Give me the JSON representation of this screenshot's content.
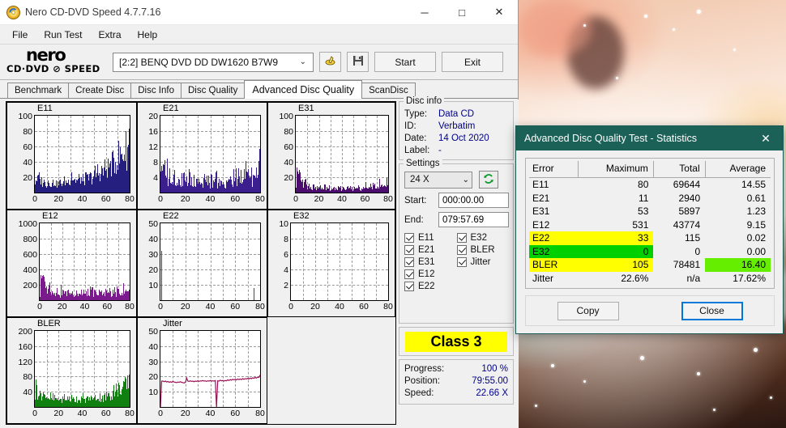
{
  "window": {
    "title": "Nero CD-DVD Speed 4.7.7.16",
    "icon": "nero-disc-icon",
    "minimize_label": "─",
    "maximize_label": "□",
    "close_label": "✕"
  },
  "menu": {
    "items": [
      "File",
      "Run Test",
      "Extra",
      "Help"
    ]
  },
  "toolbar": {
    "logo_main": "nero",
    "logo_sub": "CD·DVD ⊘ SPEED",
    "drive_selected": "[2:2]   BENQ DVD DD DW1620 B7W9",
    "drive_chevron": "⌄",
    "eject_icon": "eject-disc-icon",
    "save_icon": "floppy-save-icon",
    "start_label": "Start",
    "exit_label": "Exit"
  },
  "tabs": {
    "items": [
      "Benchmark",
      "Create Disc",
      "Disc Info",
      "Disc Quality",
      "Advanced Disc Quality",
      "ScanDisc"
    ],
    "active": "Advanced Disc Quality"
  },
  "disc_info": {
    "legend": "Disc info",
    "rows": [
      {
        "key": "Type:",
        "value": "Data CD"
      },
      {
        "key": "ID:",
        "value": "Verbatim"
      },
      {
        "key": "Date:",
        "value": "14 Oct 2020"
      },
      {
        "key": "Label:",
        "value": "-"
      }
    ]
  },
  "settings": {
    "legend": "Settings",
    "speed": "24 X",
    "speed_chevron": "⌄",
    "refresh_icon": "refresh-green-icon",
    "start_label": "Start:",
    "start_value": "000:00.00",
    "end_label": "End:",
    "end_value": "079:57.69",
    "checkboxes": [
      {
        "label": "E11",
        "checked": true
      },
      {
        "label": "E32",
        "checked": true
      },
      {
        "label": "E21",
        "checked": true
      },
      {
        "label": "BLER",
        "checked": true
      },
      {
        "label": "E31",
        "checked": true
      },
      {
        "label": "Jitter",
        "checked": true
      },
      {
        "label": "E12",
        "checked": true
      },
      {
        "label": "",
        "checked": false
      },
      {
        "label": "E22",
        "checked": true
      },
      {
        "label": "",
        "checked": false
      }
    ]
  },
  "class_badge": {
    "label": "Class 3",
    "bg": "#ffff00"
  },
  "progress": {
    "rows": [
      {
        "key": "Progress:",
        "value": "100 %"
      },
      {
        "key": "Position:",
        "value": "79:55.00"
      },
      {
        "key": "Speed:",
        "value": "22.66 X"
      }
    ]
  },
  "stats_dialog": {
    "title": "Advanced Disc Quality Test - Statistics",
    "close_icon": "close-icon",
    "close_label": "✕",
    "headers": [
      "Error",
      "Maximum",
      "Total",
      "Average"
    ],
    "rows": [
      {
        "error": "E11",
        "maximum": "80",
        "total": "69644",
        "average": "14.55",
        "hl_error": "",
        "hl_max": "",
        "hl_avg": ""
      },
      {
        "error": "E21",
        "maximum": "11",
        "total": "2940",
        "average": "0.61",
        "hl_error": "",
        "hl_max": "",
        "hl_avg": ""
      },
      {
        "error": "E31",
        "maximum": "53",
        "total": "5897",
        "average": "1.23",
        "hl_error": "",
        "hl_max": "",
        "hl_avg": ""
      },
      {
        "error": "E12",
        "maximum": "531",
        "total": "43774",
        "average": "9.15",
        "hl_error": "",
        "hl_max": "",
        "hl_avg": ""
      },
      {
        "error": "E22",
        "maximum": "33",
        "total": "115",
        "average": "0.02",
        "hl_error": "#ffff00",
        "hl_max": "#ffff00",
        "hl_avg": ""
      },
      {
        "error": "E32",
        "maximum": "0",
        "total": "0",
        "average": "0.00",
        "hl_error": "#00d000",
        "hl_max": "#00d000",
        "hl_avg": ""
      },
      {
        "error": "BLER",
        "maximum": "105",
        "total": "78481",
        "average": "16.40",
        "hl_error": "#ffff00",
        "hl_max": "#ffff00",
        "hl_avg": "#66ee00"
      },
      {
        "error": "Jitter",
        "maximum": "22.6%",
        "total": "n/a",
        "average": "17.62%",
        "hl_error": "",
        "hl_max": "",
        "hl_avg": ""
      }
    ],
    "copy_label": "Copy",
    "close_button_label": "Close"
  },
  "chart_data": [
    {
      "id": "e11",
      "type": "area",
      "title": "E11",
      "color": "#252080",
      "xlabel": "",
      "ylabel": "",
      "xlim": [
        0,
        80
      ],
      "ylim": [
        0,
        100
      ],
      "xticks": [
        0,
        20,
        40,
        60,
        80
      ],
      "yticks": [
        20,
        40,
        60,
        80,
        100
      ],
      "grid": true,
      "x": [
        0,
        1,
        2,
        3,
        4,
        5,
        6,
        7,
        8,
        9,
        10,
        11,
        12,
        13,
        14,
        15,
        16,
        17,
        18,
        19,
        20,
        21,
        22,
        23,
        24,
        25,
        26,
        27,
        28,
        29,
        30,
        31,
        32,
        33,
        34,
        35,
        36,
        37,
        38,
        39,
        40,
        41,
        42,
        43,
        44,
        45,
        46,
        47,
        48,
        49,
        50,
        51,
        52,
        53,
        54,
        55,
        56,
        57,
        58,
        59,
        60,
        61,
        62,
        63,
        64,
        65,
        66,
        67,
        68,
        69,
        70,
        71,
        72,
        73,
        74,
        75,
        76,
        77,
        78,
        79,
        80
      ],
      "values": [
        15,
        22,
        18,
        25,
        17,
        20,
        15,
        19,
        13,
        16,
        12,
        18,
        14,
        16,
        12,
        15,
        13,
        17,
        12,
        14,
        12,
        16,
        13,
        15,
        14,
        18,
        15,
        17,
        16,
        20,
        18,
        34,
        19,
        22,
        17,
        20,
        16,
        21,
        18,
        22,
        17,
        20,
        18,
        23,
        19,
        22,
        20,
        24,
        21,
        25,
        23,
        28,
        25,
        33,
        27,
        31,
        29,
        34,
        31,
        36,
        33,
        38,
        36,
        42,
        38,
        44,
        41,
        48,
        44,
        52,
        47,
        55,
        50,
        58,
        53,
        62,
        57,
        66,
        61,
        69,
        80
      ]
    },
    {
      "id": "e21",
      "type": "area",
      "title": "E21",
      "color": "#3b1f8f",
      "xlabel": "",
      "ylabel": "",
      "xlim": [
        0,
        80
      ],
      "ylim": [
        0,
        20
      ],
      "xticks": [
        0,
        20,
        40,
        60,
        80
      ],
      "yticks": [
        4,
        8,
        12,
        16,
        20
      ],
      "grid": true,
      "x": [
        0,
        1,
        2,
        3,
        4,
        5,
        6,
        7,
        8,
        9,
        10,
        11,
        12,
        13,
        14,
        15,
        16,
        17,
        18,
        19,
        20,
        21,
        22,
        23,
        24,
        25,
        26,
        27,
        28,
        29,
        30,
        31,
        32,
        33,
        34,
        35,
        36,
        37,
        38,
        39,
        40,
        41,
        42,
        43,
        44,
        45,
        46,
        47,
        48,
        49,
        50,
        51,
        52,
        53,
        54,
        55,
        56,
        57,
        58,
        59,
        60,
        61,
        62,
        63,
        64,
        65,
        66,
        67,
        68,
        69,
        70,
        71,
        72,
        73,
        74,
        75,
        76,
        77,
        78,
        79,
        80
      ],
      "values": [
        8,
        9,
        6,
        8,
        4,
        9,
        3,
        7,
        2,
        6,
        3,
        8,
        2,
        5,
        1,
        6,
        2,
        4,
        3,
        7,
        1,
        5,
        2,
        6,
        3,
        4,
        1,
        5,
        2,
        6,
        3,
        5,
        2,
        4,
        1,
        5,
        3,
        6,
        2,
        4,
        2,
        5,
        1,
        4,
        3,
        6,
        2,
        5,
        1,
        4,
        2,
        3,
        1,
        4,
        2,
        5,
        3,
        4,
        2,
        5,
        3,
        6,
        2,
        5,
        4,
        7,
        3,
        6,
        4,
        8,
        5,
        9,
        4,
        7,
        3,
        6,
        4,
        8,
        5,
        7,
        11
      ]
    },
    {
      "id": "e31",
      "type": "area",
      "title": "E31",
      "color": "#4b0d6e",
      "xlabel": "",
      "ylabel": "",
      "xlim": [
        0,
        80
      ],
      "ylim": [
        0,
        100
      ],
      "xticks": [
        0,
        20,
        40,
        60,
        80
      ],
      "yticks": [
        20,
        40,
        60,
        80,
        100
      ],
      "grid": true,
      "x": [
        0,
        1,
        2,
        3,
        4,
        5,
        6,
        7,
        8,
        9,
        10,
        11,
        12,
        13,
        14,
        15,
        16,
        17,
        18,
        19,
        20,
        21,
        22,
        23,
        24,
        25,
        26,
        27,
        28,
        29,
        30,
        31,
        32,
        33,
        34,
        35,
        36,
        37,
        38,
        39,
        40,
        41,
        42,
        43,
        44,
        45,
        46,
        47,
        48,
        49,
        50,
        51,
        52,
        53,
        54,
        55,
        56,
        57,
        58,
        59,
        60,
        61,
        62,
        63,
        64,
        65,
        66,
        67,
        68,
        69,
        70,
        71,
        72,
        73,
        74,
        75,
        76,
        77,
        78,
        79,
        80
      ],
      "values": [
        10,
        53,
        18,
        33,
        12,
        26,
        9,
        20,
        14,
        22,
        8,
        17,
        6,
        14,
        5,
        12,
        7,
        13,
        4,
        10,
        6,
        11,
        3,
        9,
        5,
        12,
        4,
        8,
        6,
        10,
        3,
        9,
        5,
        11,
        4,
        7,
        3,
        10,
        5,
        8,
        2,
        9,
        4,
        7,
        3,
        8,
        5,
        10,
        3,
        7,
        4,
        9,
        2,
        8,
        5,
        11,
        3,
        7,
        4,
        9,
        6,
        12,
        5,
        10,
        4,
        13,
        6,
        11,
        7,
        14,
        5,
        12,
        8,
        15,
        6,
        13,
        7,
        16,
        9,
        14,
        20
      ]
    },
    {
      "id": "e12",
      "type": "area",
      "title": "E12",
      "color": "#7a1a8c",
      "xlabel": "",
      "ylabel": "",
      "xlim": [
        0,
        80
      ],
      "ylim": [
        0,
        1000
      ],
      "xticks": [
        0,
        20,
        40,
        60,
        80
      ],
      "yticks": [
        200,
        400,
        600,
        800,
        1000
      ],
      "grid": true,
      "x": [
        0,
        1,
        2,
        3,
        4,
        5,
        6,
        7,
        8,
        9,
        10,
        11,
        12,
        13,
        14,
        15,
        16,
        17,
        18,
        19,
        20,
        21,
        22,
        23,
        24,
        25,
        26,
        27,
        28,
        29,
        30,
        31,
        32,
        33,
        34,
        35,
        36,
        37,
        38,
        39,
        40,
        41,
        42,
        43,
        44,
        45,
        46,
        47,
        48,
        49,
        50,
        51,
        52,
        53,
        54,
        55,
        56,
        57,
        58,
        59,
        60,
        61,
        62,
        63,
        64,
        65,
        66,
        67,
        68,
        69,
        70,
        71,
        72,
        73,
        74,
        75,
        76,
        77,
        78,
        79,
        80
      ],
      "values": [
        60,
        531,
        240,
        350,
        200,
        300,
        120,
        220,
        180,
        260,
        100,
        190,
        60,
        160,
        110,
        200,
        70,
        150,
        40,
        170,
        90,
        180,
        50,
        140,
        100,
        190,
        60,
        130,
        80,
        170,
        45,
        120,
        95,
        180,
        55,
        110,
        75,
        160,
        40,
        130,
        85,
        170,
        50,
        120,
        70,
        150,
        95,
        185,
        60,
        140,
        80,
        165,
        45,
        125,
        90,
        175,
        55,
        135,
        100,
        190,
        65,
        145,
        85,
        170,
        50,
        130,
        95,
        180,
        60,
        150,
        110,
        190,
        70,
        160,
        100,
        185,
        75,
        165,
        120,
        175,
        160
      ]
    },
    {
      "id": "e22",
      "type": "area",
      "title": "E22",
      "color": "#8c1a8c",
      "xlabel": "",
      "ylabel": "",
      "xlim": [
        0,
        80
      ],
      "ylim": [
        0,
        50
      ],
      "xticks": [
        0,
        20,
        40,
        60,
        80
      ],
      "yticks": [
        10,
        20,
        30,
        40,
        50
      ],
      "grid": true,
      "x": [
        1,
        75
      ],
      "values": [
        32,
        8
      ]
    },
    {
      "id": "e32",
      "type": "area",
      "title": "E32",
      "color": "#8c1a8c",
      "xlabel": "",
      "ylabel": "",
      "xlim": [
        0,
        80
      ],
      "ylim": [
        0,
        10
      ],
      "xticks": [
        0,
        20,
        40,
        60,
        80
      ],
      "yticks": [
        2,
        4,
        6,
        8,
        10
      ],
      "grid": true,
      "x": [],
      "values": []
    },
    {
      "id": "bler",
      "type": "area",
      "title": "BLER",
      "color": "#108010",
      "xlabel": "",
      "ylabel": "",
      "xlim": [
        0,
        80
      ],
      "ylim": [
        0,
        200
      ],
      "xticks": [
        0,
        20,
        40,
        60,
        80
      ],
      "yticks": [
        40,
        80,
        120,
        160,
        200
      ],
      "grid": true,
      "x": [
        0,
        1,
        2,
        3,
        4,
        5,
        6,
        7,
        8,
        9,
        10,
        11,
        12,
        13,
        14,
        15,
        16,
        17,
        18,
        19,
        20,
        21,
        22,
        23,
        24,
        25,
        26,
        27,
        28,
        29,
        30,
        31,
        32,
        33,
        34,
        35,
        36,
        37,
        38,
        39,
        40,
        41,
        42,
        43,
        44,
        45,
        46,
        47,
        48,
        49,
        50,
        51,
        52,
        53,
        54,
        55,
        56,
        57,
        58,
        59,
        60,
        61,
        62,
        63,
        64,
        65,
        66,
        67,
        68,
        69,
        70,
        71,
        72,
        73,
        74,
        75,
        76,
        77,
        78,
        79,
        80
      ],
      "values": [
        30,
        78,
        40,
        55,
        32,
        48,
        28,
        42,
        25,
        50,
        22,
        38,
        20,
        34,
        18,
        30,
        21,
        33,
        17,
        28,
        19,
        32,
        16,
        26,
        20,
        34,
        18,
        28,
        21,
        30,
        17,
        27,
        19,
        31,
        18,
        26,
        20,
        30,
        17,
        28,
        21,
        32,
        18,
        27,
        22,
        33,
        19,
        29,
        23,
        35,
        20,
        30,
        24,
        36,
        21,
        31,
        25,
        37,
        22,
        33,
        26,
        40,
        28,
        44,
        30,
        48,
        33,
        70,
        38,
        55,
        42,
        60,
        45,
        64,
        48,
        68,
        52,
        72,
        58,
        76,
        105
      ]
    },
    {
      "id": "jitter",
      "type": "line",
      "title": "Jitter",
      "color": "#9b1055",
      "xlabel": "",
      "ylabel": "",
      "xlim": [
        0,
        80
      ],
      "ylim": [
        0,
        50
      ],
      "xticks": [
        0,
        20,
        40,
        60,
        80
      ],
      "yticks": [
        10,
        20,
        30,
        40,
        50
      ],
      "grid": true,
      "x": [
        0,
        1,
        2,
        3,
        4,
        5,
        6,
        7,
        8,
        9,
        10,
        11,
        12,
        13,
        14,
        15,
        16,
        17,
        18,
        19,
        20,
        21,
        22,
        23,
        24,
        25,
        26,
        27,
        28,
        29,
        30,
        31,
        32,
        33,
        34,
        35,
        36,
        37,
        38,
        39,
        40,
        41,
        42,
        43,
        44,
        45,
        46,
        47,
        48,
        49,
        50,
        51,
        52,
        53,
        54,
        55,
        56,
        57,
        58,
        59,
        60,
        61,
        62,
        63,
        64,
        65,
        66,
        67,
        68,
        69,
        70,
        71,
        72,
        73,
        74,
        75,
        76,
        77,
        78,
        79,
        80
      ],
      "values": [
        0,
        17,
        17,
        16.6,
        17,
        16.4,
        16.8,
        16.2,
        16.6,
        16.2,
        16.8,
        16.4,
        16.2,
        16,
        16.4,
        16.2,
        16.6,
        16.2,
        16,
        15.8,
        16.2,
        19,
        17,
        16.8,
        17.2,
        16.8,
        17,
        16.6,
        17,
        16.8,
        17.2,
        16.8,
        17.2,
        17,
        17.4,
        17,
        17.2,
        16.8,
        17.2,
        17,
        17.4,
        17,
        17.2,
        17,
        17.4,
        0,
        17.2,
        17,
        17.6,
        17.2,
        17.4,
        17,
        17.4,
        17.2,
        17.8,
        17.4,
        18,
        17.6,
        18.2,
        17.8,
        18.2,
        17.8,
        18.4,
        18,
        18.4,
        18,
        18.6,
        18.2,
        18.6,
        18.4,
        18.8,
        18.4,
        19,
        18.6,
        19.2,
        18.8,
        19.4,
        19,
        19.6,
        19.4,
        21
      ]
    }
  ]
}
